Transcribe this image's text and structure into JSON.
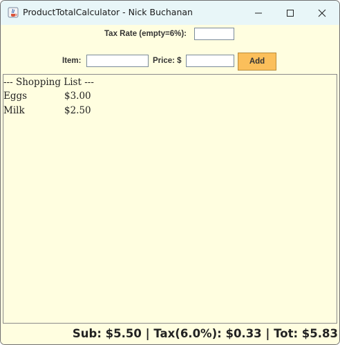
{
  "window": {
    "title": "ProductTotalCalculator - Nick Buchanan",
    "app_icon": "java-cup-icon",
    "controls": [
      "minimize-icon",
      "maximize-icon",
      "close-icon"
    ]
  },
  "tax": {
    "label": "Tax Rate (empty=6%):",
    "value": ""
  },
  "entry": {
    "item_label": "Item:",
    "item_value": "",
    "price_label": "Price: $",
    "price_value": "",
    "add_label": "Add"
  },
  "list": {
    "header": "--- Shopping List ---",
    "items": [
      {
        "name": "Eggs",
        "price": "$3.00"
      },
      {
        "name": "Milk",
        "price": "$2.50"
      }
    ]
  },
  "totals": {
    "text": "Sub: $5.50 | Tax(6.0%): $0.33 | Tot: $5.83"
  },
  "colors": {
    "background": "#fffee0",
    "titlebar": "#e8f6f8",
    "add_button": "#fbbf5b"
  }
}
